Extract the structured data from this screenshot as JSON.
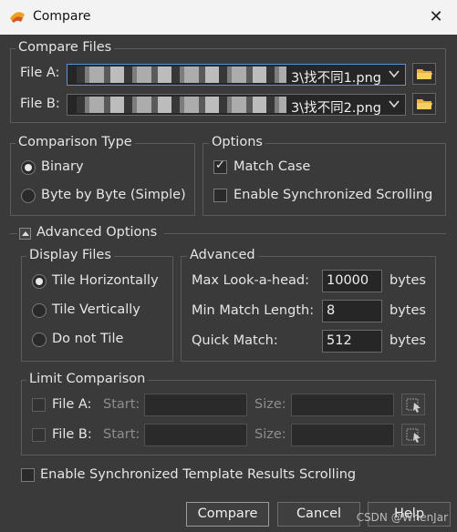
{
  "window": {
    "title": "Compare",
    "close_icon": "close-icon"
  },
  "compare_files": {
    "legend": "Compare Files",
    "file_a": {
      "label": "File A:",
      "value": "3\\找不同1.png"
    },
    "file_b": {
      "label": "File B:",
      "value": "3\\找不同2.png"
    }
  },
  "comparison_type": {
    "legend": "Comparison Type",
    "options": [
      "Binary",
      "Byte by Byte (Simple)"
    ],
    "selected": "Binary"
  },
  "options": {
    "legend": "Options",
    "match_case": {
      "label": "Match Case",
      "checked": true
    },
    "sync_scroll": {
      "label": "Enable Synchronized Scrolling",
      "checked": false
    }
  },
  "advanced_options": {
    "label": "Advanced Options"
  },
  "display_files": {
    "legend": "Display Files",
    "options": [
      "Tile Horizontally",
      "Tile Vertically",
      "Do not Tile"
    ],
    "selected": "Tile Horizontally"
  },
  "advanced": {
    "legend": "Advanced",
    "max_lookahead": {
      "label": "Max Look-a-head:",
      "value": "10000",
      "unit": "bytes"
    },
    "min_match": {
      "label": "Min Match Length:",
      "value": "8",
      "unit": "bytes"
    },
    "quick_match": {
      "label": "Quick Match:",
      "value": "512",
      "unit": "bytes"
    }
  },
  "limit_comparison": {
    "legend": "Limit Comparison",
    "file_a": {
      "label": "File A:",
      "start": "Start:",
      "size": "Size:"
    },
    "file_b": {
      "label": "File B:",
      "start": "Start:",
      "size": "Size:"
    }
  },
  "template_sync": {
    "label": "Enable Synchronized Template Results Scrolling"
  },
  "buttons": {
    "compare": "Compare",
    "cancel": "Cancel",
    "help": "Help"
  },
  "watermark": "CSDN @WhenJar"
}
